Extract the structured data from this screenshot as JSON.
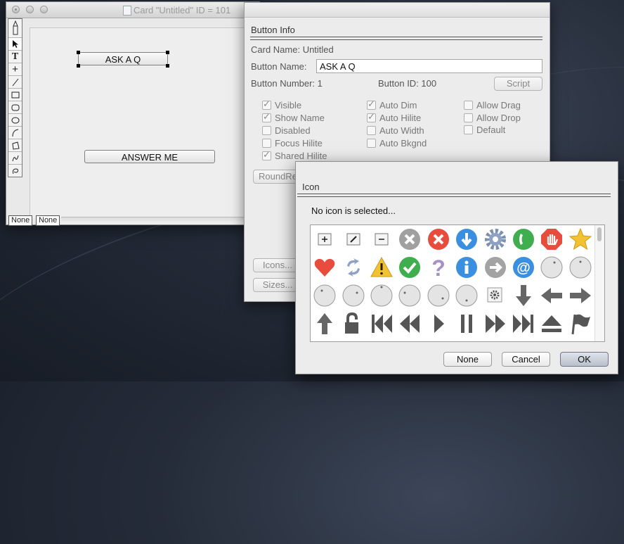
{
  "card_window": {
    "title": "Card \"Untitled\" ID = 101",
    "tools": [
      "pencil-icon",
      "arrow-icon",
      "text-icon",
      "crosshair-icon",
      "line-icon",
      "rectangle-icon",
      "round-rect-icon",
      "oval-icon",
      "curve-icon",
      "polygon-icon",
      "freehand-icon",
      "lasso-icon"
    ],
    "buttons": {
      "ask": "ASK A Q",
      "answer": "ANSWER ME"
    },
    "status": {
      "left": "None",
      "right": "None"
    }
  },
  "button_info": {
    "heading": "Button Info",
    "card_name_label": "Card Name: Untitled",
    "button_name_label": "Button Name:",
    "button_name_value": "ASK A Q",
    "button_number": "Button Number: 1",
    "button_id": "Button ID: 100",
    "script_button": "Script",
    "checkboxes_col1": [
      {
        "label": "Visible",
        "checked": true
      },
      {
        "label": "Show Name",
        "checked": true
      },
      {
        "label": "Disabled",
        "checked": false
      },
      {
        "label": "Focus Hilite",
        "checked": false
      },
      {
        "label": "Shared Hilite",
        "checked": true
      }
    ],
    "checkboxes_col2": [
      {
        "label": "Auto Dim",
        "checked": true
      },
      {
        "label": "Auto Hilite",
        "checked": true
      },
      {
        "label": "Auto Width",
        "checked": false
      },
      {
        "label": "Auto Bkgnd",
        "checked": false
      }
    ],
    "checkboxes_col3": [
      {
        "label": "Allow Drag",
        "checked": false
      },
      {
        "label": "Allow Drop",
        "checked": false
      },
      {
        "label": "Default",
        "checked": false
      }
    ],
    "style_popup": "RoundRe",
    "icons_button": "Icons...",
    "sizes_button": "Sizes..."
  },
  "icon_dialog": {
    "heading": "Icon",
    "message": "No icon is selected...",
    "icons": [
      "plus-icon",
      "pencil-icon",
      "minus-icon",
      "cancel-gray-icon",
      "cancel-red-icon",
      "download-icon",
      "gear-icon",
      "phone-icon",
      "stop-hand-icon",
      "star-icon",
      "heart-icon",
      "refresh-icon",
      "warning-icon",
      "checkmark-icon",
      "question-icon",
      "info-icon",
      "forward-arrow-icon",
      "at-sign-icon",
      "blank-sphere-icon",
      "blank-sphere-icon",
      "blank-sphere-icon",
      "blank-sphere-icon",
      "blank-sphere-icon",
      "blank-sphere-icon",
      "blank-sphere-icon",
      "small-gear-icon",
      "arrow-down-icon",
      "arrow-left-icon",
      "arrow-right-icon",
      "arrow-up-icon",
      "lock-open-icon",
      "skip-back-icon",
      "rewind-icon",
      "play-icon",
      "pause-icon",
      "fast-forward-icon",
      "skip-forward-icon",
      "eject-icon",
      "flag-icon"
    ],
    "buttons": {
      "none": "None",
      "cancel": "Cancel",
      "ok": "OK"
    }
  },
  "colors": {
    "red": "#e74c3c",
    "blue": "#3a8fe0",
    "green": "#3fae4f",
    "purple": "#a88fc8",
    "gold": "#f2c230"
  }
}
